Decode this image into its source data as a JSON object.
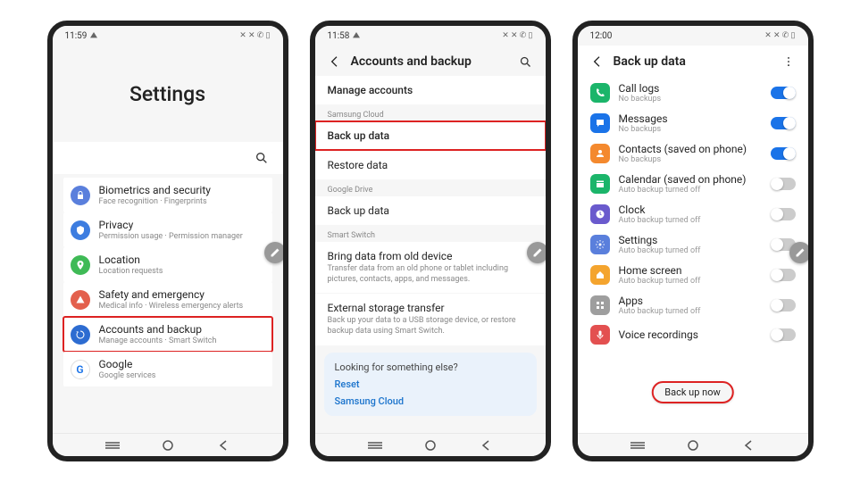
{
  "phone1": {
    "time": "11:59",
    "title": "Settings",
    "items": [
      {
        "key": "biometrics",
        "title": "Biometrics and security",
        "sub": "Face recognition · Fingerprints",
        "color": "#5a7fdc"
      },
      {
        "key": "privacy",
        "title": "Privacy",
        "sub": "Permission usage · Permission manager",
        "color": "#3d7de0"
      },
      {
        "key": "location",
        "title": "Location",
        "sub": "Location requests",
        "color": "#3fba56"
      },
      {
        "key": "safety",
        "title": "Safety and emergency",
        "sub": "Medical info · Wireless emergency alerts",
        "color": "#e3604d"
      },
      {
        "key": "accounts",
        "title": "Accounts and backup",
        "sub": "Manage accounts · Smart Switch",
        "color": "#2d6cd1",
        "highlight": true
      },
      {
        "key": "google",
        "title": "Google",
        "sub": "Google services",
        "color": "#1a73e8"
      }
    ]
  },
  "phone2": {
    "time": "11:58",
    "page_title": "Accounts and backup",
    "manage": "Manage accounts",
    "sec_samsung": "Samsung Cloud",
    "backup_data": "Back up data",
    "restore_data": "Restore data",
    "sec_gdrive": "Google Drive",
    "backup_data2": "Back up data",
    "sec_switch": "Smart Switch",
    "bring_title": "Bring data from old device",
    "bring_sub": "Transfer data from an old phone or tablet including pictures, contacts, apps, and messages.",
    "ext_title": "External storage transfer",
    "ext_sub": "Back up your data to a USB storage device, or restore backup data using Smart Switch.",
    "looking_title": "Looking for something else?",
    "reset": "Reset",
    "samsung_cloud": "Samsung Cloud"
  },
  "phone3": {
    "time": "12:00",
    "page_title": "Back up data",
    "backup_now": "Back up now",
    "items": [
      {
        "key": "call-logs",
        "title": "Call logs",
        "sub": "No backups",
        "on": true,
        "color": "#1bb56a"
      },
      {
        "key": "messages",
        "title": "Messages",
        "sub": "No backups",
        "on": true,
        "color": "#1a73e8"
      },
      {
        "key": "contacts",
        "title": "Contacts (saved on phone)",
        "sub": "No backups",
        "on": true,
        "color": "#f4892e"
      },
      {
        "key": "calendar",
        "title": "Calendar (saved on phone)",
        "sub": "Auto backup turned off",
        "on": false,
        "color": "#1bb56a"
      },
      {
        "key": "clock",
        "title": "Clock",
        "sub": "Auto backup turned off",
        "on": false,
        "color": "#6a5acd"
      },
      {
        "key": "settings",
        "title": "Settings",
        "sub": "Auto backup turned off",
        "on": false,
        "color": "#5a7fdc"
      },
      {
        "key": "homescreen",
        "title": "Home screen",
        "sub": "Auto backup turned off",
        "on": false,
        "color": "#f4a42e"
      },
      {
        "key": "apps",
        "title": "Apps",
        "sub": "Auto backup turned off",
        "on": false,
        "color": "#9e9e9e"
      },
      {
        "key": "voice-rec",
        "title": "Voice recordings",
        "sub": "",
        "on": false,
        "color": "#e35050"
      }
    ]
  }
}
